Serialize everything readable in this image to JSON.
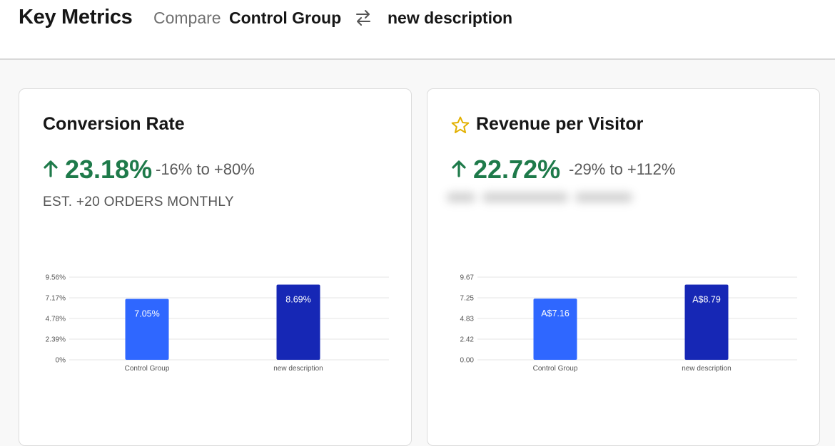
{
  "header": {
    "title": "Key Metrics",
    "compare_label": "Compare",
    "variant_a": "Control Group",
    "variant_b": "new description",
    "swap_icon": "swap-arrows-icon"
  },
  "cards": [
    {
      "title": "Conversion Rate",
      "starred": false,
      "lift": "23.18%",
      "range": "-16% to +80%",
      "estimate": "EST. +20 ORDERS MONTHLY",
      "trend_icon": "up-arrow-icon"
    },
    {
      "title": "Revenue per Visitor",
      "starred": true,
      "star_icon": "star-outline-icon",
      "lift": "22.72%",
      "range": "-29% to +112%",
      "trend_icon": "up-arrow-icon"
    }
  ],
  "colors": {
    "positive": "#1e7a4a",
    "control_bar": "#2f67ff",
    "variant_bar": "#1627b5",
    "star": "#e2b000"
  },
  "chart_data": [
    {
      "type": "bar",
      "categories": [
        "Control Group",
        "new description"
      ],
      "values": [
        7.05,
        8.69
      ],
      "bar_labels": [
        "7.05%",
        "8.69%"
      ],
      "yticks": [
        "0%",
        "2.39%",
        "4.78%",
        "7.17%",
        "9.56%"
      ],
      "ylim": [
        0,
        9.56
      ],
      "grid": true
    },
    {
      "type": "bar",
      "categories": [
        "Control Group",
        "new description"
      ],
      "values": [
        7.16,
        8.79
      ],
      "bar_labels": [
        "A$7.16",
        "A$8.79"
      ],
      "yticks": [
        "0.00",
        "2.42",
        "4.83",
        "7.25",
        "9.67"
      ],
      "ylim": [
        0,
        9.67
      ],
      "grid": true
    }
  ]
}
